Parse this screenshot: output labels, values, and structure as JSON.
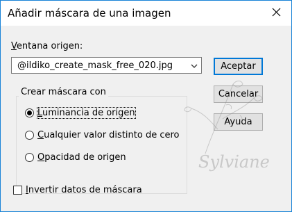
{
  "window": {
    "title": "Añadir máscara de una imagen",
    "close_icon": "close-icon"
  },
  "source": {
    "label_accel": "V",
    "label_rest": "entana origen:",
    "selected": "@ildiko_create_mask_free_020.jpg",
    "dropdown_icon": "chevron-down-icon"
  },
  "buttons": {
    "accept": "Aceptar",
    "cancel": "Cancelar",
    "help": "Ayuda"
  },
  "mask_group": {
    "title": "Crear máscara con",
    "options": [
      {
        "accel": "L",
        "rest": "uminancia de origen",
        "checked": true
      },
      {
        "accel": "C",
        "rest": "ualquier valor distinto de cero",
        "checked": false
      },
      {
        "accel": "O",
        "rest": "pacidad de origen",
        "checked": false
      }
    ]
  },
  "invert": {
    "accel": "I",
    "rest": "nvertir datos de máscara",
    "checked": false
  },
  "watermark": {
    "text": "Sylviane"
  }
}
